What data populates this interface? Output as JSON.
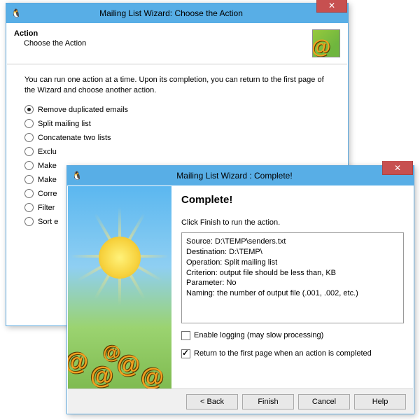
{
  "window1": {
    "title": "Mailing List Wizard: Choose the Action",
    "header_title": "Action",
    "header_sub": "Choose the Action",
    "intro": "You can run one action at a time. Upon its completion, you can return to the first page of the Wizard and choose another action.",
    "options": [
      "Remove duplicated emails",
      "Split mailing list",
      "Concatenate two lists",
      "Exclu",
      "Make",
      "Make",
      "Corre",
      "Filter",
      "Sort e"
    ],
    "selected_index": 0
  },
  "window2": {
    "title": "Mailing List Wizard : Complete!",
    "heading": "Complete!",
    "instruction": "Click Finish to run the action.",
    "summary": {
      "source": "Source: D:\\TEMP\\senders.txt",
      "destination": "Destination: D:\\TEMP\\",
      "operation": "Operation: Split mailing list",
      "criterion": "Criterion: output file should be less than, KB",
      "parameter": "Parameter: No",
      "naming": "Naming: the number of output file (.001, .002, etc.)"
    },
    "enable_logging_label": "Enable logging (may slow processing)",
    "enable_logging_checked": false,
    "return_first_label": "Return to the first page when an action is completed",
    "return_first_checked": true,
    "buttons": {
      "back": "< Back",
      "finish": "Finish",
      "cancel": "Cancel",
      "help": "Help"
    }
  }
}
